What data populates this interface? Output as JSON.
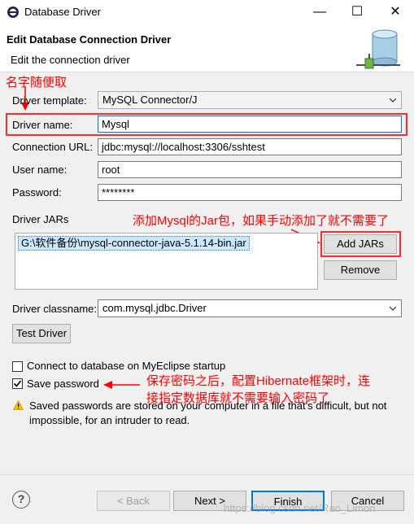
{
  "window": {
    "title": "Database Driver",
    "minimize": "—",
    "maximize": "☐",
    "close": "✕"
  },
  "header": {
    "title": "Edit Database Connection Driver",
    "description": "Edit the connection driver"
  },
  "annotations": {
    "name_hint": "名字随便取",
    "jar_hint": "添加Mysql的Jar包，如果手动添加了就不需要了",
    "save_hint_line1": "保存密码之后，配置Hibernate框架时，连",
    "save_hint_line2": "接指定数据库就不需要输入密码了"
  },
  "form": {
    "template_label": "Driver template:",
    "template_value": "MySQL Connector/J",
    "name_label": "Driver name:",
    "name_value": "Mysql",
    "url_label": "Connection URL:",
    "url_value": "jdbc:mysql://localhost:3306/sshtest",
    "user_label": "User name:",
    "user_value": "root",
    "password_label": "Password:",
    "password_value": "********",
    "jars_label": "Driver JARs",
    "jars": [
      "G:\\软件备份\\mysql-connector-java-5.1.14-bin.jar"
    ],
    "add_jars": "Add JARs",
    "remove": "Remove",
    "classname_label": "Driver classname:",
    "classname_value": "com.mysql.jdbc.Driver",
    "test_driver": "Test Driver",
    "connect_on_startup": "Connect to database on MyEclipse startup",
    "connect_on_startup_checked": false,
    "save_password": "Save password",
    "save_password_checked": true,
    "warning": "Saved passwords are stored on your computer in a file that's difficult, but not impossible, for an intruder to read."
  },
  "footer": {
    "help": "?",
    "back": "< Back",
    "next": "Next >",
    "finish": "Finish",
    "cancel": "Cancel"
  },
  "watermark": "https://blog.csdn.net/Rao_Limon",
  "colors": {
    "annotation": "#ff0000",
    "selection": "#cce8ff",
    "focus_border": "#0078d7"
  }
}
